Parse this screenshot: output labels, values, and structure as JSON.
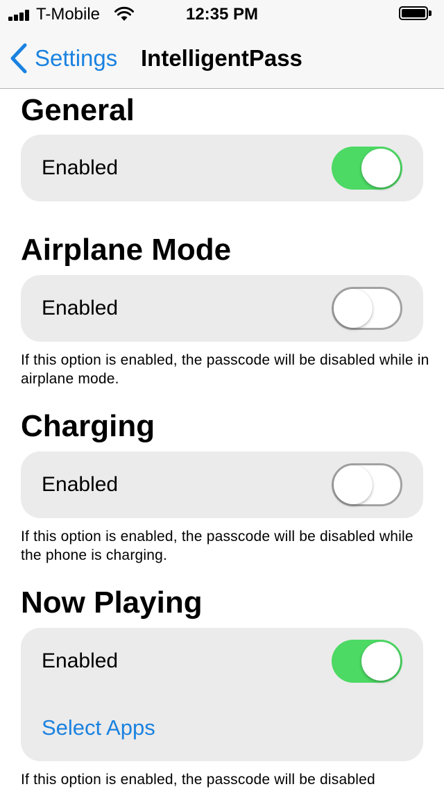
{
  "status_bar": {
    "carrier": "T-Mobile",
    "time": "12:35 PM",
    "signal_icon": "signal-bars-icon",
    "wifi_icon": "wifi-icon",
    "battery_icon": "battery-icon"
  },
  "nav": {
    "back_label": "Settings",
    "back_icon": "chevron-left-icon",
    "title": "IntelligentPass"
  },
  "sections": [
    {
      "title": "General",
      "row_label": "Enabled",
      "toggle_on": true,
      "footnote": ""
    },
    {
      "title": "Airplane Mode",
      "row_label": "Enabled",
      "toggle_on": false,
      "footnote": "If this option is enabled, the passcode will be disabled while in airplane mode."
    },
    {
      "title": "Charging",
      "row_label": "Enabled",
      "toggle_on": false,
      "footnote": "If this option is enabled, the passcode will be disabled while the phone is charging."
    },
    {
      "title": "Now Playing",
      "row_label": "Enabled",
      "toggle_on": true,
      "link_label": "Select Apps",
      "footnote": "If this option is enabled, the passcode will be disabled"
    }
  ],
  "colors": {
    "accent": "#1a82e0",
    "toggle_on": "#4cd964",
    "card_background": "#ebebeb",
    "bar_background": "#f7f7f7"
  }
}
